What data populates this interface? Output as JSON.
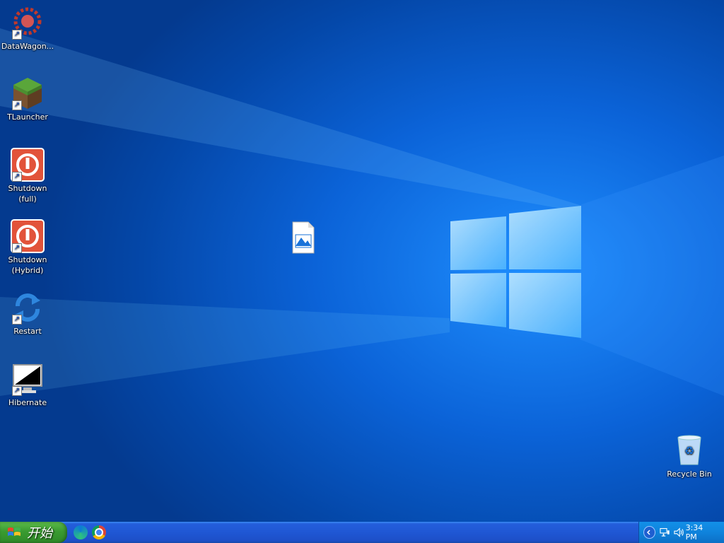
{
  "desktop": {
    "icons": [
      {
        "label": "DataWagon..."
      },
      {
        "label": "TLauncher"
      },
      {
        "label": "Shutdown\n(full)"
      },
      {
        "label": "Shutdown\n(Hybrid)"
      },
      {
        "label": "Restart"
      },
      {
        "label": "Hibernate"
      },
      {
        "label": ""
      },
      {
        "label": "Recycle Bin"
      }
    ]
  },
  "taskbar": {
    "start_label": "开始",
    "quick_launch": [
      {
        "icon": "edge-icon"
      },
      {
        "icon": "chrome-icon"
      }
    ],
    "tray": {
      "clock": "3:34 PM"
    }
  }
}
